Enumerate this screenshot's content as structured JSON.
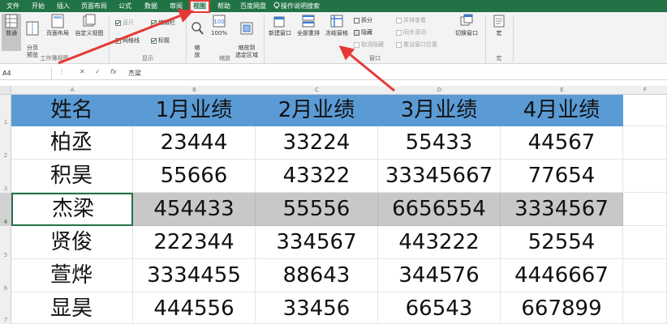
{
  "tabs": [
    "文件",
    "开始",
    "插入",
    "页面布局",
    "公式",
    "数据",
    "审阅",
    "视图",
    "帮助",
    "百度网盘",
    "操作说明搜索"
  ],
  "active_tab_index": 7,
  "ribbon": {
    "workbook_views": {
      "label": "工作簿视图",
      "buttons": [
        "普通",
        "分页\n预览",
        "页面布局",
        "自定义视图"
      ]
    },
    "show": {
      "label": "显示",
      "items": [
        {
          "text": "直尺",
          "checked": true,
          "disabled": true
        },
        {
          "text": "编辑栏",
          "checked": true,
          "disabled": false
        },
        {
          "text": "网格线",
          "checked": true,
          "disabled": false
        },
        {
          "text": "标题",
          "checked": true,
          "disabled": false
        }
      ]
    },
    "zoom": {
      "label": "缩放",
      "buttons": [
        "缩\n放",
        "100%",
        "缩放到\n选定区域"
      ]
    },
    "window": {
      "label": "窗口",
      "buttons": [
        "新建窗口",
        "全部重排",
        "冻结窗格"
      ],
      "small": [
        {
          "text": "拆分",
          "disabled": false
        },
        {
          "text": "隐藏",
          "disabled": false
        },
        {
          "text": "取消隐藏",
          "disabled": true
        },
        {
          "text": "并排查看",
          "disabled": true
        },
        {
          "text": "同步滚动",
          "disabled": true
        },
        {
          "text": "重设窗口位置",
          "disabled": true
        }
      ],
      "switch": "切换窗口"
    },
    "macro": {
      "label": "宏",
      "button": "宏"
    }
  },
  "formula_bar": {
    "name_box": "A4",
    "formula": "杰梁"
  },
  "columns": [
    "A",
    "B",
    "C",
    "D",
    "E",
    "F"
  ],
  "rows": [
    "1",
    "2",
    "3",
    "4",
    "5",
    "6",
    "7"
  ],
  "sheet": {
    "header": [
      "姓名",
      "1月业绩",
      "2月业绩",
      "3月业绩",
      "4月业绩"
    ],
    "data": [
      [
        "柏丞",
        "23444",
        "33224",
        "55433",
        "44567"
      ],
      [
        "积昊",
        "55666",
        "43322",
        "33345667",
        "77654"
      ],
      [
        "杰梁",
        "454433",
        "55556",
        "6656554",
        "3334567"
      ],
      [
        "贤俊",
        "222344",
        "334567",
        "443222",
        "52554"
      ],
      [
        "萱烨",
        "3334455",
        "88643",
        "344576",
        "4446667"
      ],
      [
        "显昊",
        "444556",
        "33456",
        "66543",
        "667899"
      ]
    ],
    "highlighted_row": 2
  },
  "colors": {
    "excel_green": "#217346",
    "header_fill": "#5b9bd5",
    "highlight_fill": "#c8c8c8",
    "annotation_red": "#e53935"
  },
  "icons": {
    "search": "lightbulb-search-icon",
    "freeze": "freeze-panes-icon"
  }
}
